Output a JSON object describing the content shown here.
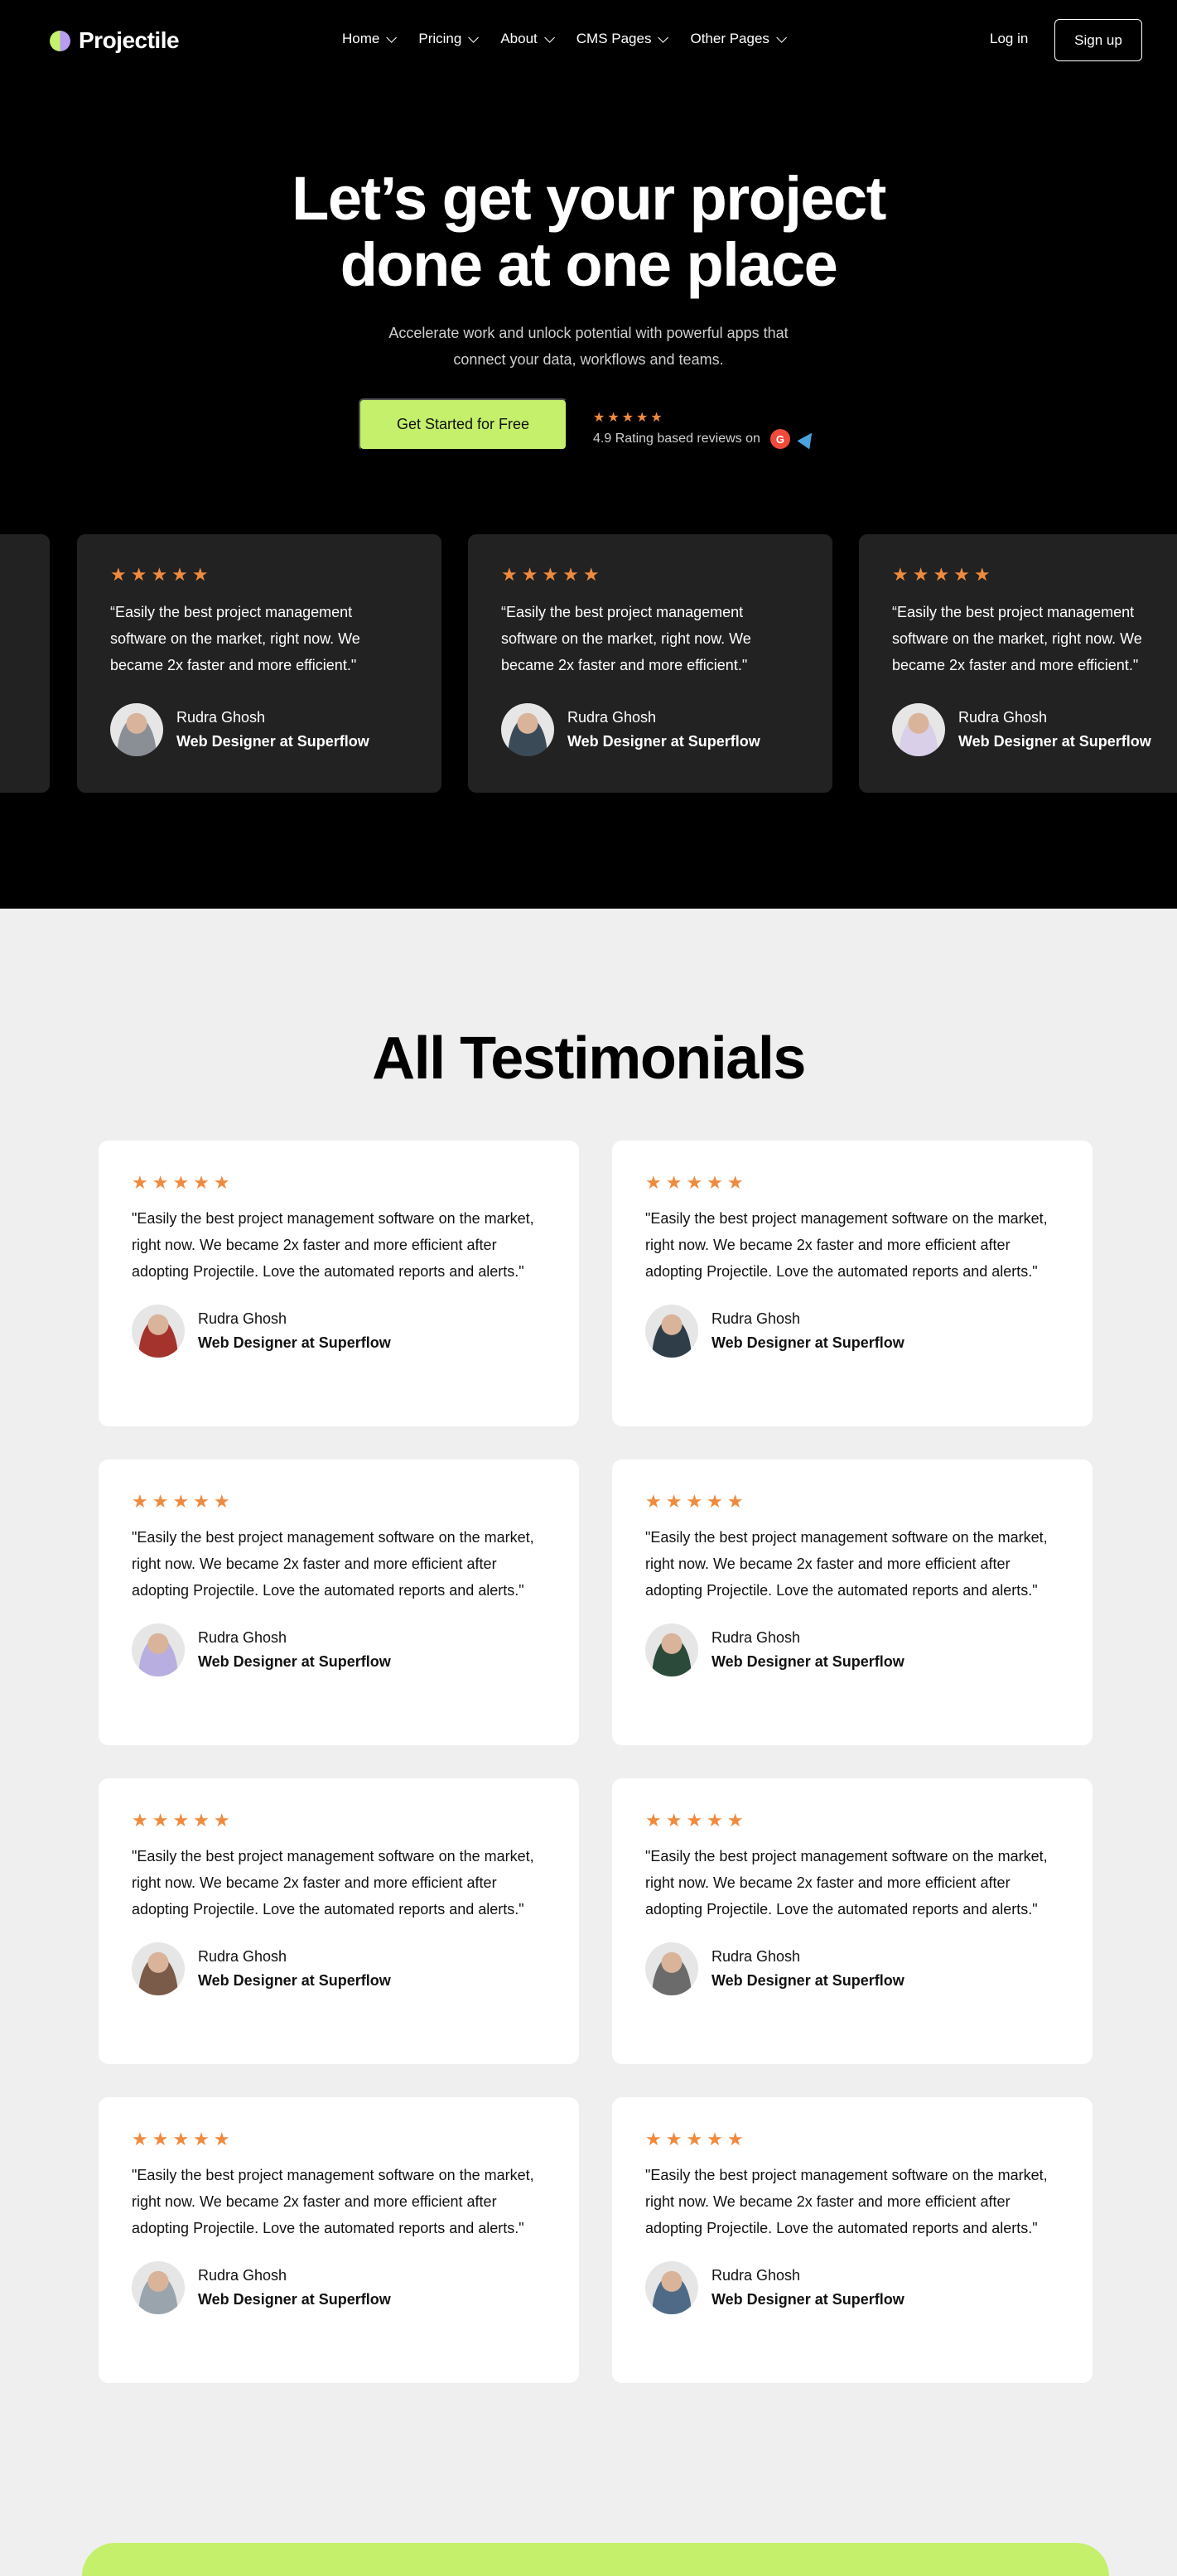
{
  "nav": {
    "brand": "Projectile",
    "items": [
      {
        "label": "Home"
      },
      {
        "label": "Pricing"
      },
      {
        "label": "About"
      },
      {
        "label": "CMS Pages"
      },
      {
        "label": "Other Pages"
      }
    ],
    "login": "Log in",
    "signup": "Sign up"
  },
  "hero": {
    "title_line1": "Let’s get your project",
    "title_line2": "done at one place",
    "subtitle_line1": "Accelerate work and unlock potential with powerful apps that",
    "subtitle_line2": "connect your data, workflows and teams.",
    "cta": "Get Started for Free",
    "stars": "★★★★★",
    "rating_text": "4.9 Rating based reviews on",
    "g2_label": "G",
    "review_icons": [
      "g2-icon",
      "capterra-icon"
    ]
  },
  "carousel": [
    {
      "stars": "★★★★★",
      "quote": "“Easily the best project management software on the market, right now. We became 2x faster and more efficient.\"",
      "name": "Rudra Ghosh",
      "role": "Web Designer at Superflow",
      "avatar_color": "#8a8f96"
    },
    {
      "stars": "★★★★★",
      "quote": "“Easily the best project management software on the market, right now. We became 2x faster and more efficient.\"",
      "name": "Rudra Ghosh",
      "role": "Web Designer at Superflow",
      "avatar_color": "#3b4a57"
    },
    {
      "stars": "★★★★★",
      "quote": "“Easily the best project management software on the market, right now. We became 2x faster and more efficient.\"",
      "name": "Rudra Ghosh",
      "role": "Web Designer at Superflow",
      "avatar_color": "#d9cfe8"
    }
  ],
  "testimonials": {
    "title": "All Testimonials",
    "items": [
      {
        "stars": "★★★★★",
        "quote": "\"Easily the best project management software on the market, right now. We became 2x faster and more efficient after adopting Projectile. Love the automated reports and alerts.\"",
        "name": "Rudra Ghosh",
        "role": "Web Designer at Superflow",
        "avatar_color": "#a3332c"
      },
      {
        "stars": "★★★★★",
        "quote": "\"Easily the best project management software on the market, right now. We became 2x faster and more efficient after adopting Projectile. Love the automated reports and alerts.\"",
        "name": "Rudra Ghosh",
        "role": "Web Designer at Superflow",
        "avatar_color": "#2f3d48"
      },
      {
        "stars": "★★★★★",
        "quote": "\"Easily the best project management software on the market, right now. We became 2x faster and more efficient after adopting Projectile. Love the automated reports and alerts.\"",
        "name": "Rudra Ghosh",
        "role": "Web Designer at Superflow",
        "avatar_color": "#b9aee0"
      },
      {
        "stars": "★★★★★",
        "quote": "\"Easily the best project management software on the market, right now. We became 2x faster and more efficient after adopting Projectile. Love the automated reports and alerts.\"",
        "name": "Rudra Ghosh",
        "role": "Web Designer at Superflow",
        "avatar_color": "#2c4a3a"
      },
      {
        "stars": "★★★★★",
        "quote": "\"Easily the best project management software on the market, right now. We became 2x faster and more efficient after adopting Projectile. Love the automated reports and alerts.\"",
        "name": "Rudra Ghosh",
        "role": "Web Designer at Superflow",
        "avatar_color": "#7a5a48"
      },
      {
        "stars": "★★★★★",
        "quote": "\"Easily the best project management software on the market, right now. We became 2x faster and more efficient after adopting Projectile. Love the automated reports and alerts.\"",
        "name": "Rudra Ghosh",
        "role": "Web Designer at Superflow",
        "avatar_color": "#6b6b6b"
      },
      {
        "stars": "★★★★★",
        "quote": "\"Easily the best project management software on the market, right now. We became 2x faster and more efficient after adopting Projectile. Love the automated reports and alerts.\"",
        "name": "Rudra Ghosh",
        "role": "Web Designer at Superflow",
        "avatar_color": "#9aa4ad"
      },
      {
        "stars": "★★★★★",
        "quote": "\"Easily the best project management software on the market, right now. We became 2x faster and more efficient after adopting Projectile. Love the automated reports and alerts.\"",
        "name": "Rudra Ghosh",
        "role": "Web Designer at Superflow",
        "avatar_color": "#4f6a86"
      }
    ]
  },
  "colors": {
    "accent": "#c4f06b",
    "star": "#ef8a3e",
    "hero_bg": "#000000",
    "card_dark": "#222222",
    "page_bg": "#efefef"
  }
}
